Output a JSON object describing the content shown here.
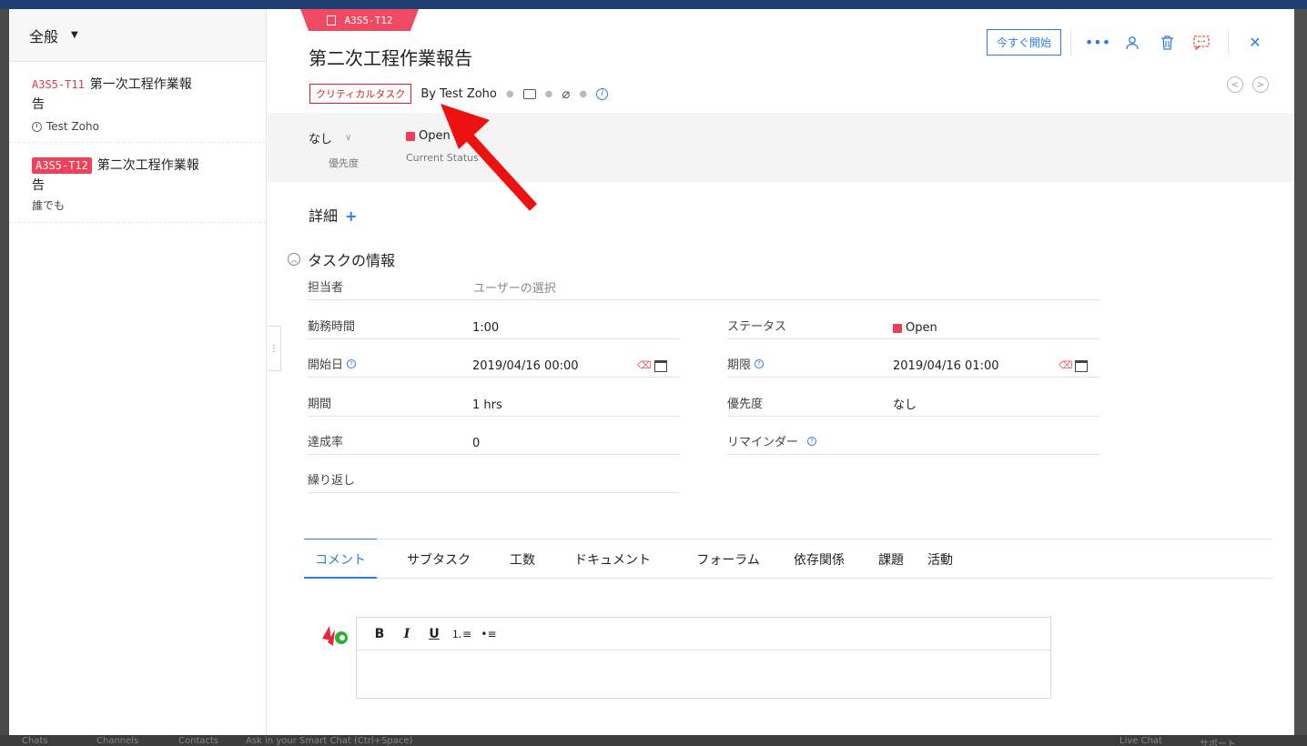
{
  "background": {
    "bottom_items": [
      "Chats",
      "Channels",
      "Contacts"
    ],
    "bottom_search_placeholder": "Ask in your Smart Chat (Ctrl+Space)",
    "live_chat": "Live Chat",
    "support": "サポート"
  },
  "left_panel": {
    "filter_label": "全般",
    "tasks": [
      {
        "id": "A3S5-T11",
        "title_line1": "第一次工程作業報",
        "title_line2": "告",
        "owner": "Test Zoho"
      },
      {
        "id": "A3S5-T12",
        "title_line1": "第二次工程作業報",
        "title_line2": "告",
        "owner": "誰でも"
      }
    ]
  },
  "task": {
    "ribbon_id": "A3S5-T12",
    "title": "第二次工程作業報告",
    "tag": "クリティカルタスク",
    "by": "By Test Zoho",
    "start_button": "今すぐ開始",
    "priority_value": "なし",
    "priority_label": "優先度",
    "status_value": "Open",
    "status_label": "Current Status",
    "status_color": "#ee3c5a"
  },
  "sections": {
    "details": "詳細",
    "details_add": "+",
    "task_info": "タスクの情報"
  },
  "fields": {
    "assignee_label": "担当者",
    "assignee_placeholder": "ユーザーの選択",
    "work_hours_label": "勤務時間",
    "work_hours_value": "1:00",
    "status_label": "ステータス",
    "status_value": "Open",
    "start_date_label": "開始日",
    "start_date_value": "2019/04/16 00:00",
    "due_date_label": "期限",
    "due_date_value": "2019/04/16 01:00",
    "duration_label": "期間",
    "duration_value": "1 hrs",
    "priority_label": "優先度",
    "priority_value": "なし",
    "completion_label": "達成率",
    "completion_value": "0",
    "reminder_label": "リマインダー",
    "recurrence_label": "繰り返し"
  },
  "tabs": [
    "コメント",
    "サブタスク",
    "工数",
    "ドキュメント",
    "フォーラム",
    "依存関係",
    "課題",
    "活動"
  ],
  "editor": {
    "bold": "B",
    "italic": "I",
    "underline": "U"
  },
  "annotation_arrow_color": "#ee1111"
}
